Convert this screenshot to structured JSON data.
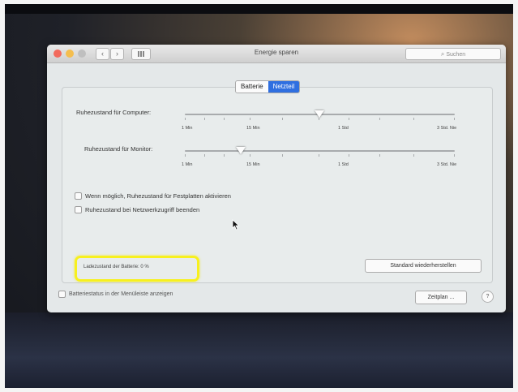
{
  "window": {
    "title": "Energie sparen",
    "search_placeholder": "Suchen",
    "nav_back": "‹",
    "nav_forward": "›"
  },
  "tabs": [
    {
      "label": "Batterie",
      "selected": false
    },
    {
      "label": "Netzteil",
      "selected": true
    }
  ],
  "sliders": [
    {
      "label": "Ruhezustand für Computer:",
      "value": "1 Std."
    },
    {
      "label": "Ruhezustand für Monitor:",
      "value": "10 Min."
    }
  ],
  "scale_labels": [
    "1 Min",
    "15 Min",
    "1 Std",
    "3 Std. Nie"
  ],
  "checkboxes": [
    {
      "label": "Wenn möglich, Ruhezustand für Festplatten aktivieren",
      "checked": false
    },
    {
      "label": "Ruhezustand bei Netzwerkzugriff beenden",
      "checked": false
    }
  ],
  "battery_level": "Ladezustand der Batterie: 0 %",
  "restore_defaults": "Standard wiederherstellen",
  "show_battery_status": "Batteriestatus in der Menüleiste anzeigen",
  "schedule_button": "Zeitplan ...",
  "help_button": "?",
  "colors": {
    "selected_tab": "#2f6fe0",
    "highlight_ring": "#f7f01e"
  }
}
